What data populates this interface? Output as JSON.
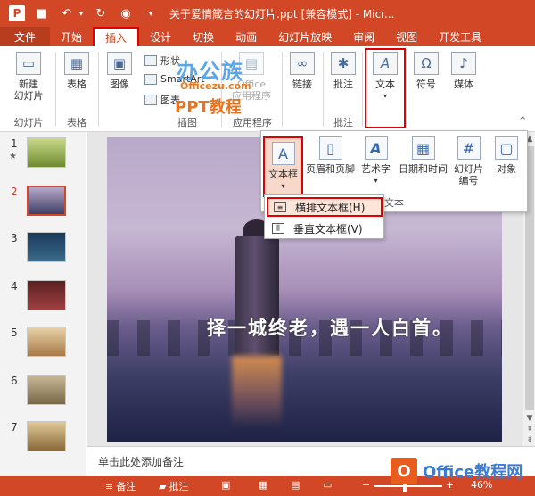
{
  "titlebar": {
    "app_icon": "P",
    "title": "关于爱情箴言的幻灯片.ppt [兼容模式] - Micr..."
  },
  "menu": {
    "tabs": [
      "文件",
      "开始",
      "插入",
      "设计",
      "切换",
      "动画",
      "幻灯片放映",
      "审阅",
      "视图",
      "开发工具"
    ]
  },
  "ribbon": {
    "new_slide": "新建\n幻灯片",
    "slides_group": "幻灯片",
    "table": "表格",
    "tables_group": "表格",
    "image": "图像",
    "shapes": "形状",
    "smartart": "SmartArt",
    "chart": "图表",
    "illustrations_group": "插图",
    "office_apps": "Office\n应用程序",
    "apps_group": "应用程序",
    "link": "链接",
    "comment": "批注",
    "comments_group": "批注",
    "text": "文本",
    "symbol": "符号",
    "media": "媒体"
  },
  "dropdown": {
    "textbox": "文本框",
    "header_footer": "页眉和页脚",
    "wordart": "艺术字",
    "datetime": "日期和时间",
    "slide_number": "幻灯片\n编号",
    "object": "对象",
    "group_label": "文本"
  },
  "submenu": {
    "horizontal": "横排文本框(H)",
    "vertical": "垂直文本框(V)"
  },
  "thumbnails": [
    {
      "num": "1",
      "star": "★",
      "color": "#9fb24a"
    },
    {
      "num": "2",
      "star": "",
      "color": "#6b5d8f"
    },
    {
      "num": "3",
      "star": "",
      "color": "#244a6a"
    },
    {
      "num": "4",
      "star": "",
      "color": "#7a3030"
    },
    {
      "num": "5",
      "star": "",
      "color": "#c9a46a"
    },
    {
      "num": "6",
      "star": "",
      "color": "#9a8868"
    },
    {
      "num": "7",
      "star": "",
      "color": "#b58a4a"
    }
  ],
  "slide": {
    "text": "择一城终老，遇一人白首。"
  },
  "notes": {
    "placeholder": "单击此处添加备注"
  },
  "status": {
    "notes": "备注",
    "comments": "批注",
    "zoom": "46%"
  },
  "watermark": {
    "brand": "办公族",
    "url": "Officezu.com",
    "ppt": "PPT教程",
    "corner_logo": "O",
    "corner_text": "Office教程网"
  }
}
